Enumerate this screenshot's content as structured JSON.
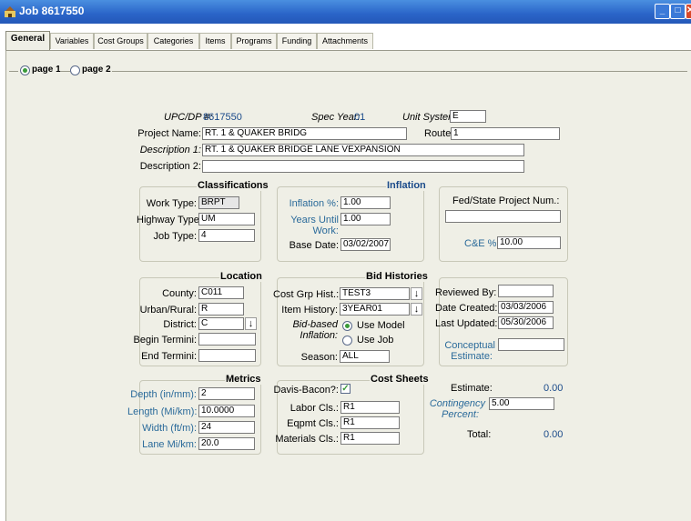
{
  "window": {
    "title": "Job 8617550"
  },
  "tabs": [
    "General",
    "Variables",
    "Cost Groups",
    "Categories",
    "Items",
    "Programs",
    "Funding",
    "Attachments"
  ],
  "pages": [
    "page 1",
    "page 2"
  ],
  "header": {
    "upc_label": "UPC/DP #:",
    "upc_value": "8617550",
    "spec_year_label": "Spec Year:",
    "spec_year_value": "01",
    "unit_system_label": "Unit System:",
    "unit_system_value": "E",
    "project_name_label": "Project Name:",
    "project_name_value": "RT. 1 & QUAKER BRIDG",
    "route_label": "Route:",
    "route_value": "1",
    "desc1_label": "Description 1:",
    "desc1_value": "RT. 1 & QUAKER BRIDGE LANE VEXPANSION",
    "desc2_label": "Description 2:",
    "desc2_value": ""
  },
  "classifications": {
    "title": "Classifications",
    "work_type_label": "Work Type:",
    "work_type_value": "BRPT",
    "highway_type_label": "Highway Type:",
    "highway_type_value": "UM",
    "job_type_label": "Job Type:",
    "job_type_value": "4"
  },
  "inflation": {
    "title": "Inflation",
    "inflation_pct_label": "Inflation %:",
    "inflation_pct_value": "1.00",
    "years_until_label1": "Years Until",
    "years_until_label2": "Work:",
    "years_until_value": "1.00",
    "base_date_label": "Base Date:",
    "base_date_value": "03/02/2007"
  },
  "fed_state": {
    "label": "Fed/State Project Num.:",
    "value": "",
    "ce_label": "C&E %:",
    "ce_value": "10.00"
  },
  "location": {
    "title": "Location",
    "county_label": "County:",
    "county_value": "C011",
    "urban_label": "Urban/Rural:",
    "urban_value": "R",
    "district_label": "District:",
    "district_value": "C",
    "begin_label": "Begin Termini:",
    "begin_value": "",
    "end_label": "End Termini:",
    "end_value": ""
  },
  "bid_histories": {
    "title": "Bid Histories",
    "cost_grp_label": "Cost Grp Hist.:",
    "cost_grp_value": "TEST3",
    "item_history_label": "Item History:",
    "item_history_value": "3YEAR01",
    "bid_based_label1": "Bid-based",
    "bid_based_label2": "Inflation:",
    "use_model": "Use Model",
    "use_job": "Use Job",
    "season_label": "Season:",
    "season_value": "ALL"
  },
  "review": {
    "reviewed_by_label": "Reviewed By:",
    "reviewed_by_value": "",
    "date_created_label": "Date Created:",
    "date_created_value": "03/03/2006",
    "last_updated_label": "Last Updated:",
    "last_updated_value": "05/30/2006",
    "conceptual_label1": "Conceptual",
    "conceptual_label2": "Estimate:",
    "conceptual_value": ""
  },
  "metrics": {
    "title": "Metrics",
    "depth_label": "Depth (in/mm):",
    "depth_value": "2",
    "length_label": "Length (Mi/km):",
    "length_value": "10.0000",
    "width_label": "Width (ft/m):",
    "width_value": "24",
    "lane_label": "Lane Mi/km:",
    "lane_value": "20.0"
  },
  "cost_sheets": {
    "title": "Cost Sheets",
    "davis_label": "Davis-Bacon?:",
    "davis_checked": true,
    "labor_label": "Labor Cls.:",
    "labor_value": "R1",
    "eqpmt_label": "Eqpmt Cls.:",
    "eqpmt_value": "R1",
    "materials_label": "Materials Cls.:",
    "materials_value": "R1"
  },
  "estimate": {
    "estimate_label": "Estimate:",
    "estimate_value": "0.00",
    "contingency_label1": "Contingency",
    "contingency_label2": "Percent:",
    "contingency_value": "5.00",
    "total_label": "Total:",
    "total_value": "0.00"
  },
  "colors": {
    "titlebar": "#2a64c8",
    "panel": "#efefe6",
    "label_blue": "#1a4a8a"
  }
}
